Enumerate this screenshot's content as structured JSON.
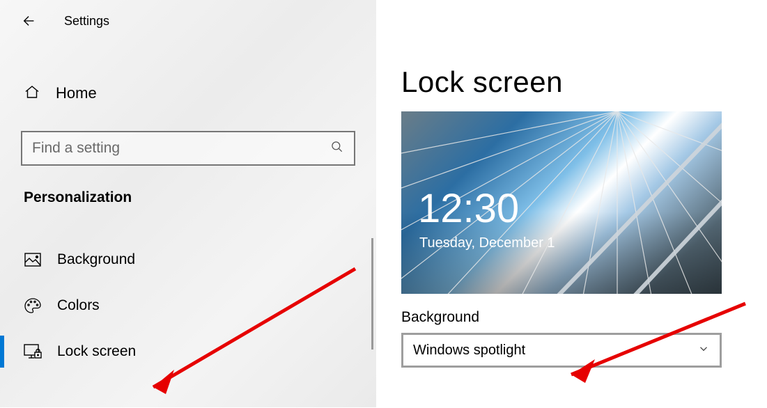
{
  "titlebar": {
    "title": "Settings"
  },
  "home": {
    "label": "Home"
  },
  "search": {
    "placeholder": "Find a setting"
  },
  "section": {
    "label": "Personalization"
  },
  "nav": {
    "items": [
      {
        "label": "Background"
      },
      {
        "label": "Colors"
      },
      {
        "label": "Lock screen"
      }
    ]
  },
  "main": {
    "heading": "Lock screen",
    "preview": {
      "time": "12:30",
      "date": "Tuesday, December 1"
    },
    "background_label": "Background",
    "dropdown_value": "Windows spotlight"
  }
}
